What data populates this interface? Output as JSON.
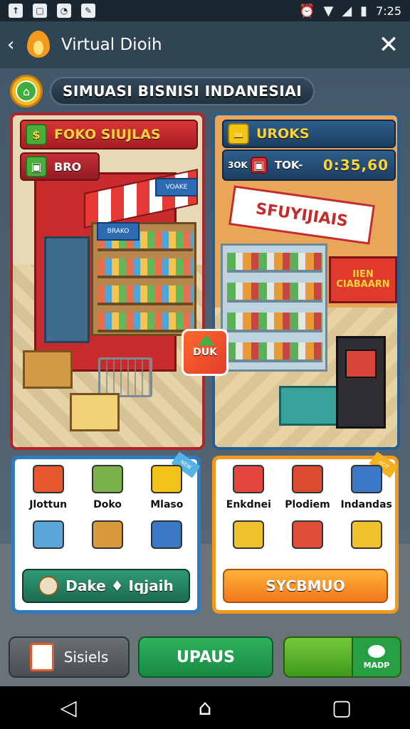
{
  "status_bar": {
    "time": "7:25"
  },
  "app_bar": {
    "title": "Virtual Dioih"
  },
  "game": {
    "title": "SIMUASI BISNISI INDANESIAI",
    "left_store": {
      "name": "FOKO SIUJLAS",
      "sub": "BRO",
      "awning_sign": "VOAKE",
      "shelf_sign": "BRAKO"
    },
    "right_store": {
      "name": "UROKS",
      "code": "3OK",
      "label": "TOK-",
      "money": "0:35,60",
      "banner": "SFUYIJIAIS",
      "side_sign": "IIEN CIABAARN"
    },
    "center_badge": "DUK",
    "left_card": {
      "ribbon": "NEW",
      "items": [
        {
          "label": "Jlottun",
          "icon": "truck-icon",
          "color": "#e8562f"
        },
        {
          "label": "Doko",
          "icon": "cash-icon",
          "color": "#7cb24a"
        },
        {
          "label": "Mlaso",
          "icon": "taxi-icon",
          "color": "#f1c318"
        },
        {
          "label": "",
          "icon": "boxes-icon",
          "color": "#5aa6d8"
        },
        {
          "label": "",
          "icon": "crate-icon",
          "color": "#d89a3d"
        },
        {
          "label": "",
          "icon": "van-icon",
          "color": "#3b79c5"
        }
      ],
      "button": "Dake ♦ Iqjaih"
    },
    "right_card": {
      "ribbon": "HOT",
      "items": [
        {
          "label": "Enkdnei",
          "icon": "magnifier-icon",
          "color": "#e2463f"
        },
        {
          "label": "Plodiem",
          "icon": "box-icon",
          "color": "#de4a2f"
        },
        {
          "label": "Indandas",
          "icon": "solar-panel-icon",
          "color": "#3a78c9"
        },
        {
          "label": "",
          "icon": "forklift-icon",
          "color": "#f0c12a"
        },
        {
          "label": "",
          "icon": "delivery-truck-icon",
          "color": "#e24d3a"
        },
        {
          "label": "",
          "icon": "cab-icon",
          "color": "#f0c12a"
        }
      ],
      "button": "SYCBMUO"
    },
    "bottom": {
      "stats_label": "Sisiels",
      "upgrade_label": "UPAUS",
      "map_label": "MADP"
    }
  }
}
